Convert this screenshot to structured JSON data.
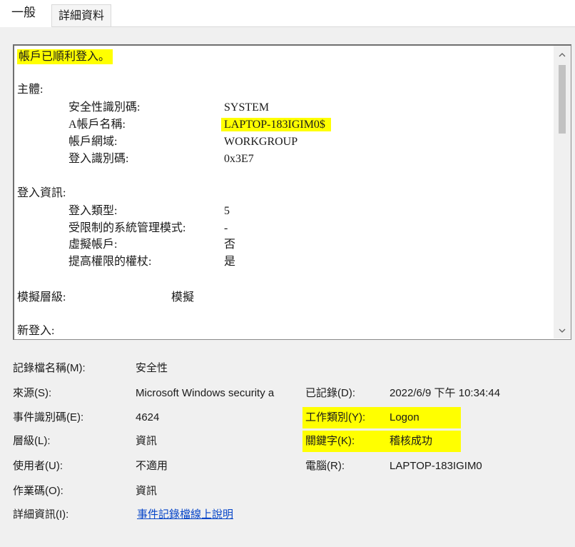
{
  "tabs": {
    "general": "一般",
    "details": "詳細資料"
  },
  "description": {
    "headline": "帳戶已順利登入。",
    "subject_header": "主體:",
    "subject": [
      {
        "label": "安全性識別碼:",
        "value": "SYSTEM"
      },
      {
        "label": "A帳戶名稱:",
        "value": "LAPTOP-183IGIM0$"
      },
      {
        "label": "帳戶網域:",
        "value": "WORKGROUP"
      },
      {
        "label": "登入識別碼:",
        "value": "0x3E7"
      }
    ],
    "logon_info_header": "登入資訊:",
    "logon_info": [
      {
        "label": "登入類型:",
        "value": "5"
      },
      {
        "label": "受限制的系統管理模式:",
        "value": "-"
      },
      {
        "label": "虛擬帳戶:",
        "value": "否"
      },
      {
        "label": "提高權限的權杖:",
        "value": "是"
      }
    ],
    "impersonation_label": "模擬層級:",
    "impersonation_value": "模擬",
    "new_logon_header": "新登入:"
  },
  "scrollbar": {
    "up_icon": "chevron-up",
    "down_icon": "chevron-down"
  },
  "properties": {
    "log_name_label": "記錄檔名稱(M):",
    "log_name_value": "安全性",
    "source_label": "來源(S):",
    "source_value": "Microsoft Windows security a",
    "logged_label": "已記錄(D):",
    "logged_value": "2022/6/9 下午 10:34:44",
    "event_id_label": "事件識別碼(E):",
    "event_id_value": "4624",
    "task_category_label": "工作類別(Y):",
    "task_category_value": "Logon",
    "level_label": "層級(L):",
    "level_value": "資訊",
    "keywords_label": "關鍵字(K):",
    "keywords_value": "稽核成功",
    "user_label": "使用者(U):",
    "user_value": "不適用",
    "computer_label": "電腦(R):",
    "computer_value": "LAPTOP-183IGIM0",
    "opcode_label": "作業碼(O):",
    "opcode_value": "資訊",
    "more_info_label": "詳細資訊(I):",
    "more_info_link": "事件記錄檔線上說明"
  },
  "colors": {
    "highlight": "#ffff00",
    "link": "#0645c8",
    "panel_bg": "#f0f0f0"
  }
}
